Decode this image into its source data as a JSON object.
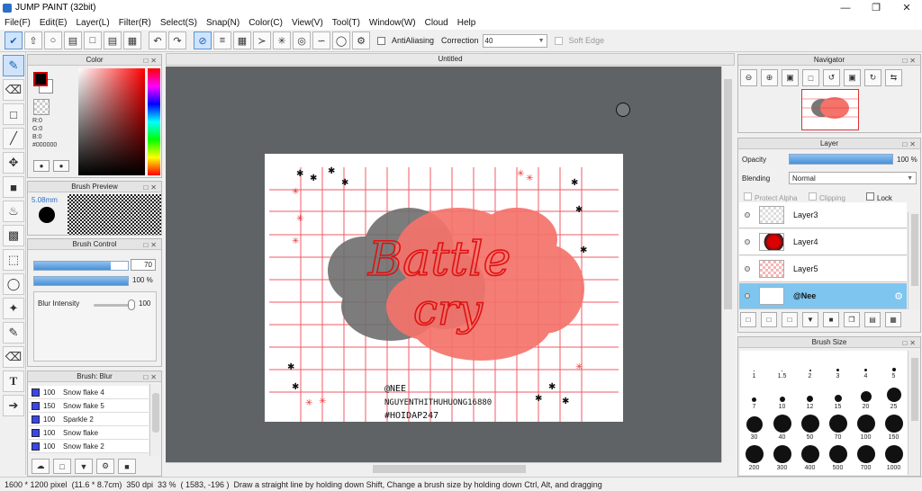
{
  "app": {
    "title": "JUMP PAINT (32bit)"
  },
  "menu": [
    "File(F)",
    "Edit(E)",
    "Layer(L)",
    "Filter(R)",
    "Select(S)",
    "Snap(N)",
    "Color(C)",
    "View(V)",
    "Tool(T)",
    "Window(W)",
    "Cloud",
    "Help"
  ],
  "toolbar": {
    "antialiasing_label": "AntiAliasing",
    "correction_label": "Correction",
    "correction_value": "40",
    "soft_edge_label": "Soft Edge"
  },
  "color_panel": {
    "title": "Color",
    "r": "R:0",
    "g": "G:0",
    "b": "B:0",
    "hex": "#000000",
    "fg_color": "#000000",
    "bg_color": "#ffffff"
  },
  "brush_preview": {
    "title": "Brush Preview",
    "size": "5.08mm"
  },
  "brush_control": {
    "title": "Brush Control",
    "size_value": "70",
    "opacity_value": "100",
    "opacity_unit": "%",
    "size_fraction": 0.82,
    "opacity_fraction": 1.0,
    "blur_label": "Blur Intensity",
    "blur_value": "100"
  },
  "brush_blur": {
    "title": "Brush: Blur",
    "items": [
      {
        "size": "100",
        "name": "Snow flake 4"
      },
      {
        "size": "150",
        "name": "Snow flake 5"
      },
      {
        "size": "100",
        "name": "Sparkle 2"
      },
      {
        "size": "100",
        "name": "Snow flake"
      },
      {
        "size": "100",
        "name": "Snow flake 2"
      }
    ]
  },
  "document": {
    "tab_title": "Untitled"
  },
  "artwork": {
    "title_line1": "Battle",
    "title_line2": "cry",
    "credit1": "@NEE",
    "credit2": "NGUYENTHITHUHUONG16880",
    "credit3": "#HOIDAP247"
  },
  "navigator": {
    "title": "Navigator"
  },
  "layer_panel": {
    "title": "Layer",
    "opacity_label": "Opacity",
    "opacity_value": "100",
    "opacity_unit": "%",
    "blending_label": "Blending",
    "blending_value": "Normal",
    "protect_alpha_label": "Protect Alpha",
    "clipping_label": "Clipping",
    "lock_label": "Lock",
    "layers": [
      {
        "name": "Layer3"
      },
      {
        "name": "Layer4"
      },
      {
        "name": "Layer5"
      },
      {
        "name": "@Nee",
        "selected": true
      }
    ]
  },
  "brush_size": {
    "title": "Brush Size",
    "sizes": [
      "1",
      "1.5",
      "2",
      "3",
      "4",
      "5",
      "7",
      "10",
      "12",
      "15",
      "20",
      "25",
      "30",
      "40",
      "50",
      "70",
      "100",
      "150",
      "200",
      "300",
      "400",
      "500",
      "700",
      "1000"
    ]
  },
  "status": {
    "dimensions": "1600 * 1200 pixel",
    "physical": "(11.6 * 8.7cm)",
    "dpi": "350 dpi",
    "zoom": "33 %",
    "coords": "( 1583, -196 )",
    "hint": "Draw a straight line by holding down Shift, Change a brush size by holding down Ctrl, Alt, and dragging"
  }
}
